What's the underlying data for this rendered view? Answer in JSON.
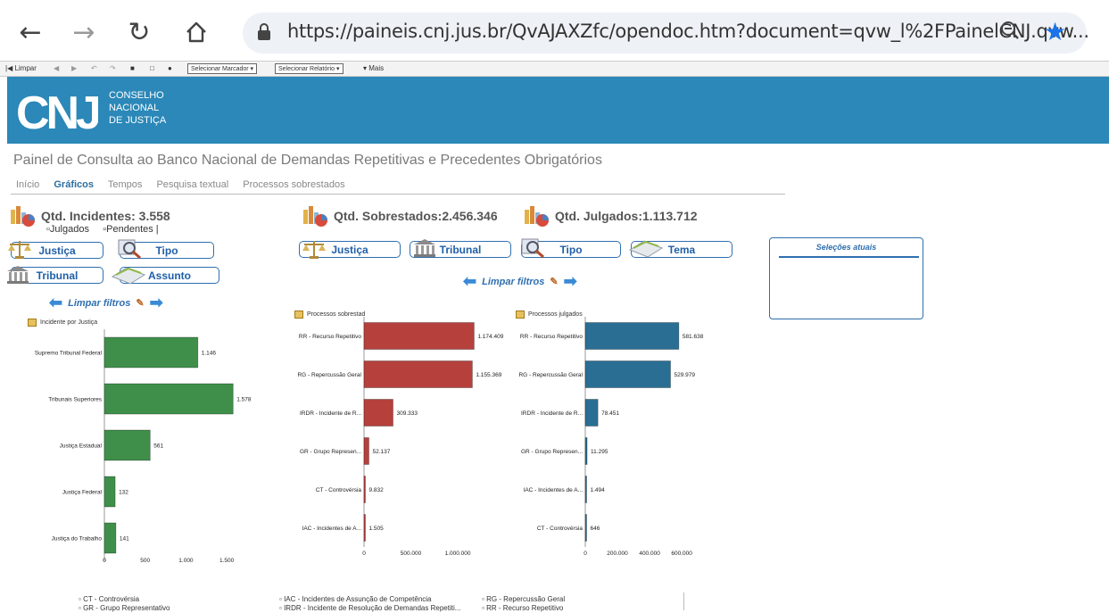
{
  "browser": {
    "url": "https://paineis.cnj.jus.br/QvAJAXZfc/opendoc.htm?document=qvw_l%2FPainelCNJ.qvw..."
  },
  "toolbar": {
    "limpar": "Limpar",
    "marcador": "Selecionar Marcador",
    "relatorio": "Selecionar Relatório",
    "mais": "Mais"
  },
  "header": {
    "logo_letters": "CNJ",
    "org_line1": "CONSELHO",
    "org_line2": "NACIONAL",
    "org_line3": "DE JUSTIÇA"
  },
  "page_title": "Painel de Consulta ao Banco Nacional de Demandas Repetitivas e Precedentes Obrigatórios",
  "tabs": [
    "Início",
    "Gráficos",
    "Tempos",
    "Pesquisa textual",
    "Processos sobrestados"
  ],
  "kpis": {
    "incidentes": "Qtd. Incidentes: 3.558",
    "sobrestados": "Qtd. Sobrestados:2.456.346",
    "julgados": "Qtd. Julgados:1.113.712"
  },
  "checkboxes": {
    "julgados": "Julgados",
    "pendentes": "Pendentes"
  },
  "filters_left": {
    "justica": "Justiça",
    "tipo": "Tipo",
    "tribunal": "Tribunal",
    "assunto": "Assunto"
  },
  "filters_mid": {
    "justica": "Justiça",
    "tribunal": "Tribunal",
    "tipo": "Tipo",
    "tema": "Tema"
  },
  "limpar_filtros": "Limpar filtros",
  "selecoes_atuais": "Seleções atuais",
  "chart_data": [
    {
      "type": "bar",
      "orientation": "horizontal",
      "title": "Incidente por Justiça",
      "categories": [
        "Supremo Tribunal Federal",
        "Tribunais Superiores",
        "Justiça Estadual",
        "Justiça Federal",
        "Justiça do Trabalho"
      ],
      "values": [
        1146,
        1578,
        561,
        132,
        141
      ],
      "value_labels": [
        "1.146",
        "1.578",
        "561",
        "132",
        "141"
      ],
      "xticks": [
        "0",
        "500",
        "1.000",
        "1.500"
      ],
      "xlim": [
        0,
        1750
      ],
      "color": "#3f8f4a"
    },
    {
      "type": "bar",
      "orientation": "horizontal",
      "title": "Processos sobrestad",
      "categories": [
        "RR - Recurso Repetitivo",
        "RG - Repercussão Geral",
        "IRDR - Incidente de R...",
        "GR - Grupo Represen...",
        "CT - Controvérsia",
        "IAC - Incidentes de A..."
      ],
      "values": [
        1174409,
        1155369,
        309333,
        52137,
        9832,
        1505
      ],
      "value_labels": [
        "1.174.409",
        "1.155.369",
        "309.333",
        "52.137",
        "9.832",
        "1.505"
      ],
      "xticks": [
        "0",
        "500.000",
        "1.000.000"
      ],
      "xlim": [
        0,
        1380000
      ],
      "color": "#b5403c"
    },
    {
      "type": "bar",
      "orientation": "horizontal",
      "title": "Processos julgados",
      "categories": [
        "RR - Recurso Repetitivo",
        "RG - Repercussão Geral",
        "IRDR - Incidente de R...",
        "GR - Grupo Represen...",
        "IAC - Incidentes de A...",
        "CT - Controvérsia"
      ],
      "values": [
        581638,
        529979,
        78451,
        11295,
        1494,
        646
      ],
      "value_labels": [
        "581.638",
        "529.979",
        "78.451",
        "11.295",
        "1.494",
        "646"
      ],
      "xticks": [
        "0",
        "200.000",
        "400.000",
        "600.000"
      ],
      "xlim": [
        0,
        860000
      ],
      "color": "#2a6f93"
    }
  ],
  "legend": {
    "col1": [
      "CT - Controvérsia",
      "GR - Grupo Representativo"
    ],
    "col2": [
      "IAC - Incidentes de Assunção de Competência",
      "IRDR - Incidente de Resolução de Demandas Repetiti..."
    ],
    "col3": [
      "RG - Repercussão Geral",
      "RR - Recurso Repetitivo"
    ]
  }
}
